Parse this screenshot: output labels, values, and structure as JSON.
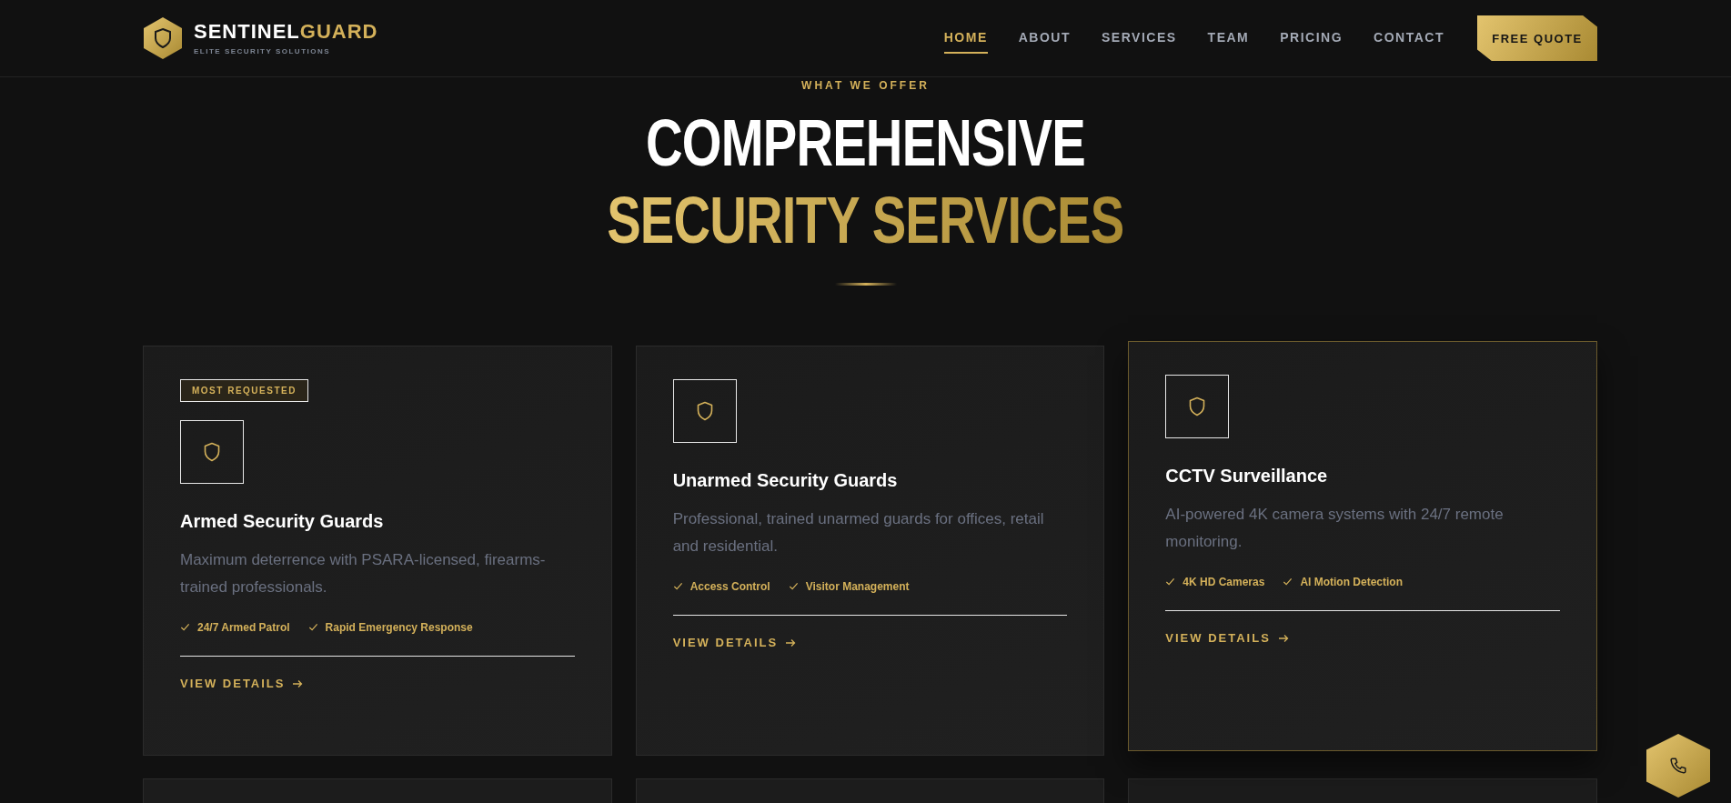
{
  "header": {
    "brand_primary": "SENTINEL",
    "brand_accent": "GUARD",
    "tagline": "ELITE SECURITY SOLUTIONS",
    "nav": [
      {
        "label": "HOME",
        "selected": true
      },
      {
        "label": "ABOUT",
        "selected": false
      },
      {
        "label": "SERVICES",
        "selected": false
      },
      {
        "label": "TEAM",
        "selected": false
      },
      {
        "label": "PRICING",
        "selected": false
      },
      {
        "label": "CONTACT",
        "selected": false
      }
    ],
    "cta": "FREE QUOTE"
  },
  "section": {
    "eyebrow": "WHAT WE OFFER",
    "title_line_1": "COMPREHENSIVE",
    "title_line_2": "SECURITY SERVICES"
  },
  "services": [
    {
      "badge": "MOST REQUESTED",
      "title": "Armed Security Guards",
      "description": "Maximum deterrence with PSARA-licensed, firearms-trained professionals.",
      "features": [
        "24/7 Armed Patrol",
        "Rapid Emergency Response"
      ],
      "link": "VIEW DETAILS",
      "highlighted": false
    },
    {
      "title": "Unarmed Security Guards",
      "description": "Professional, trained unarmed guards for offices, retail and residential.",
      "features": [
        "Access Control",
        "Visitor Management"
      ],
      "link": "VIEW DETAILS",
      "highlighted": false
    },
    {
      "title": "CCTV Surveillance",
      "description": "AI-powered 4K camera systems with 24/7 remote monitoring.",
      "features": [
        "4K HD Cameras",
        "AI Motion Detection"
      ],
      "link": "VIEW DETAILS",
      "highlighted": true
    }
  ]
}
